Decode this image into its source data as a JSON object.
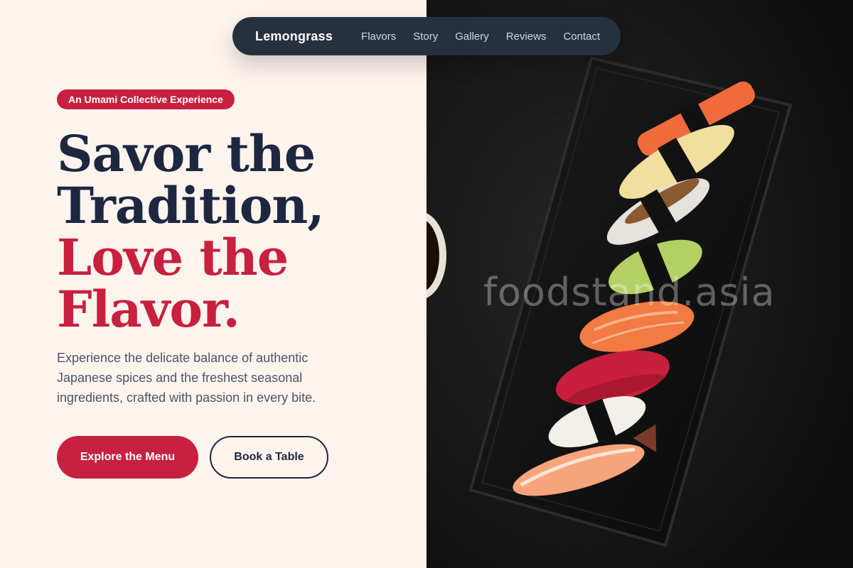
{
  "nav": {
    "brand": "Lemongrass",
    "links": [
      {
        "label": "Flavors"
      },
      {
        "label": "Story"
      },
      {
        "label": "Gallery"
      },
      {
        "label": "Reviews"
      },
      {
        "label": "Contact"
      }
    ]
  },
  "hero": {
    "badge": "An Umami Collective Experience",
    "headline": {
      "line1": "Savor the",
      "line2": "Tradition,",
      "line3": "Love the",
      "line4": "Flavor."
    },
    "description": "Experience the delicate balance of authentic Japanese spices and the freshest seasonal ingredients, crafted with passion in every bite.",
    "primary_button": "Explore the Menu",
    "secondary_button": "Book a Table"
  },
  "image": {
    "watermark": "foodstand.asia"
  },
  "colors": {
    "accent": "#c8203f",
    "navy": "#1d2740",
    "background": "#fdf4ee",
    "nav_background": "#26313f"
  }
}
